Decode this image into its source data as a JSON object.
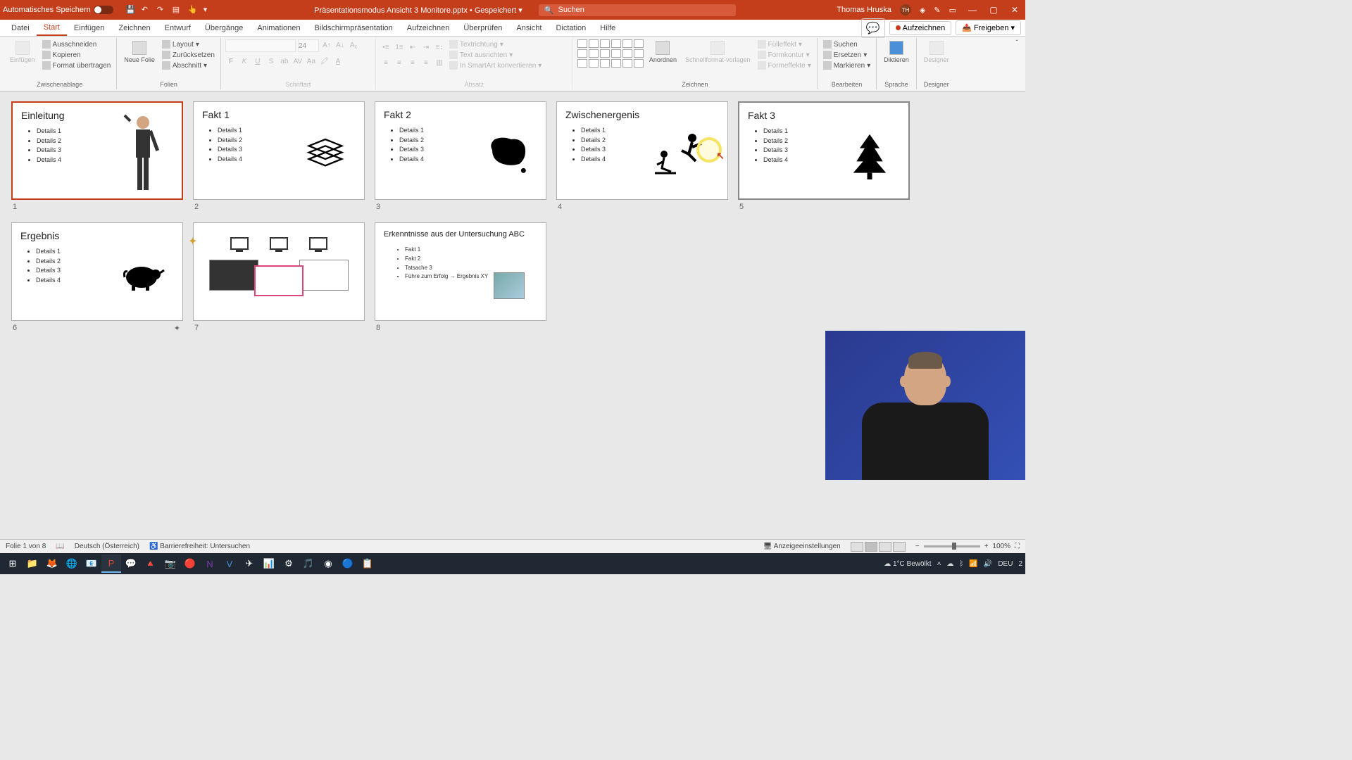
{
  "titlebar": {
    "autosave": "Automatisches Speichern",
    "filename": "Präsentationsmodus Ansicht 3 Monitore.pptx",
    "saved": "Gespeichert",
    "search_placeholder": "Suchen",
    "user": "Thomas Hruska",
    "initials": "TH"
  },
  "tabs": {
    "datei": "Datei",
    "start": "Start",
    "einfuegen": "Einfügen",
    "zeichnen": "Zeichnen",
    "entwurf": "Entwurf",
    "uebergaenge": "Übergänge",
    "animationen": "Animationen",
    "bildschirm": "Bildschirmpräsentation",
    "aufzeichnen_tab": "Aufzeichnen",
    "ueberpruefen": "Überprüfen",
    "ansicht": "Ansicht",
    "dictation": "Dictation",
    "hilfe": "Hilfe",
    "aufzeichnen_btn": "Aufzeichnen",
    "freigeben": "Freigeben"
  },
  "ribbon": {
    "paste": "Einfügen",
    "cut": "Ausschneiden",
    "copy": "Kopieren",
    "format_painter": "Format übertragen",
    "clipboard": "Zwischenablage",
    "new_slide": "Neue Folie",
    "layout": "Layout",
    "reset": "Zurücksetzen",
    "section": "Abschnitt",
    "slides": "Folien",
    "font_size": "24",
    "font": "Schriftart",
    "paragraph": "Absatz",
    "text_direction": "Textrichtung",
    "align_text": "Text ausrichten",
    "smartart": "In SmartArt konvertieren",
    "arrange": "Anordnen",
    "quick_styles": "Schnellformat-vorlagen",
    "shape_fill": "Fülleffekt",
    "shape_outline": "Formkontur",
    "shape_effects": "Formeffekte",
    "drawing": "Zeichnen",
    "find": "Suchen",
    "replace": "Ersetzen",
    "select": "Markieren",
    "editing": "Bearbeiten",
    "dictate": "Diktieren",
    "voice": "Sprache",
    "designer": "Designer",
    "designer_grp": "Designer"
  },
  "slides": [
    {
      "title": "Einleitung",
      "bullets": [
        "Details 1",
        "Details 2",
        "Details 3",
        "Details 4"
      ],
      "num": "1"
    },
    {
      "title": "Fakt 1",
      "bullets": [
        "Details 1",
        "Details 2",
        "Details 3",
        "Details 4"
      ],
      "num": "2"
    },
    {
      "title": "Fakt 2",
      "bullets": [
        "Details 1",
        "Details 2",
        "Details 3",
        "Details 4"
      ],
      "num": "3"
    },
    {
      "title": "Zwischenergenis",
      "bullets": [
        "Details 1",
        "Details 2",
        "Details 3",
        "Details 4"
      ],
      "num": "4"
    },
    {
      "title": "Fakt 3",
      "bullets": [
        "Details 1",
        "Details 2",
        "Details 3",
        "Details 4"
      ],
      "num": "5"
    },
    {
      "title": "Ergebnis",
      "bullets": [
        "Details 1",
        "Details 2",
        "Details 3",
        "Details 4"
      ],
      "num": "6"
    },
    {
      "title": "",
      "bullets": [],
      "num": "7"
    },
    {
      "title": "Erkenntnisse aus der Untersuchung ABC",
      "bullets": [
        "Fakt 1",
        "Fakt 2",
        "Tatsache 3",
        "Führe zum Erfolg → Ergebnis XY"
      ],
      "num": "8"
    }
  ],
  "status": {
    "slide_count": "Folie 1 von 8",
    "lang": "Deutsch (Österreich)",
    "accessibility": "Barrierefreiheit: Untersuchen",
    "display_settings": "Anzeigeeinstellungen",
    "zoom": "100%"
  },
  "taskbar": {
    "weather": "1°C  Bewölkt",
    "lang": "DEU",
    "time": "2"
  }
}
